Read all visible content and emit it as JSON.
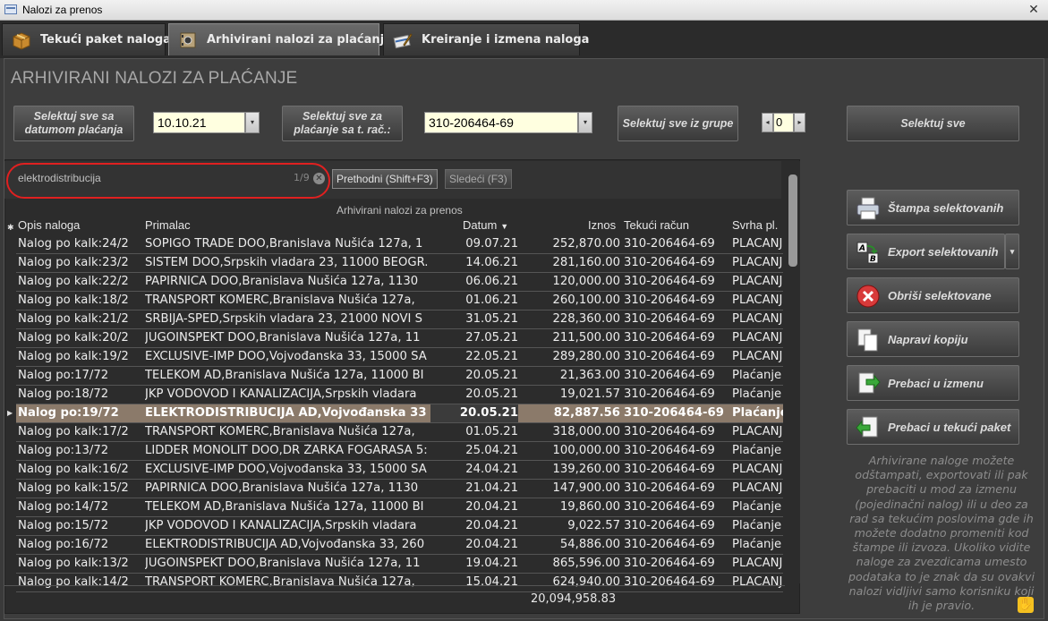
{
  "window": {
    "title": "Nalozi za prenos"
  },
  "tabs": [
    {
      "label": "Tekući paket naloga",
      "icon": "package-icon"
    },
    {
      "label": "Arhivirani nalozi za plaćanje",
      "icon": "safe-icon",
      "active": true
    },
    {
      "label": "Kreiranje i izmena naloga",
      "icon": "pen-card-icon"
    }
  ],
  "page_title": "ARHIVIRANI NALOZI ZA PLAĆANJE",
  "filters": {
    "select_by_date_label": "Selektuj sve sa datumom plaćanja",
    "date_value": "10.10.21",
    "select_by_account_label": "Selektuj sve za plaćanje sa t. rač.:",
    "account_value": "310-206464-69",
    "select_by_group_label": "Selektuj sve iz grupe",
    "group_value": "0",
    "select_all_label": "Selektuj sve"
  },
  "search": {
    "value": "elektrodistribucija",
    "count": "1/9",
    "prev_label": "Prethodni (Shift+F3)",
    "next_label": "Sledeći (F3)"
  },
  "grid": {
    "caption": "Arhivirani nalozi za prenos",
    "columns": [
      "Opis naloga",
      "Primalac",
      "Datum",
      "Iznos",
      "Tekući račun",
      "Svrha pl."
    ],
    "rows": [
      [
        "Nalog po kalk:24/2",
        "ŠOPIGO TRADE DOO,Branislava Nušića 127a, 1",
        "09.07.21",
        "252,870.00",
        "310-206464-69",
        "PLAĆANJ"
      ],
      [
        "Nalog po kalk:23/2",
        "SISTEM DOO,Srpskih vladara 23, 11000 BEOGR.",
        "14.06.21",
        "281,160.00",
        "310-206464-69",
        "PLAĆANJ"
      ],
      [
        "Nalog po kalk:22/2",
        "PAPIRNICA DOO,Branislava Nušića 127a, 1130",
        "06.06.21",
        "120,000.00",
        "310-206464-69",
        "PLAĆANJ"
      ],
      [
        "Nalog po kalk:18/2",
        "TRANSPORT KOMERC,Branislava Nušića 127a,",
        "01.06.21",
        "260,100.00",
        "310-206464-69",
        "PLAĆANJ"
      ],
      [
        "Nalog po kalk:21/2",
        "SRBIJA-ŠPED,Srpskih vladara 23, 21000 NOVI S",
        "31.05.21",
        "228,360.00",
        "310-206464-69",
        "PLAĆANJ"
      ],
      [
        "Nalog po kalk:20/2",
        "JUGOINSPEKT DOO,Branislava Nušića 127a, 11",
        "27.05.21",
        "211,500.00",
        "310-206464-69",
        "PLAĆANJ"
      ],
      [
        "Nalog po kalk:19/2",
        "EXCLUSIVE-IMP DOO,Vojvođanska 33, 15000 ŠA",
        "22.05.21",
        "289,280.00",
        "310-206464-69",
        "PLAĆANJ"
      ],
      [
        "Nalog po:17/72",
        "TELEKOM AD,Branislava Nušića 127a, 11000 BI",
        "20.05.21",
        "21,363.00",
        "310-206464-69",
        "Plaćanje"
      ],
      [
        "Nalog po:18/72",
        "JKP VODOVOD I KANALIZACIJA,Srpskih vladara",
        "20.05.21",
        "19,021.57",
        "310-206464-69",
        "Plaćanje"
      ],
      [
        "Nalog po:19/72",
        "ELEKTRODISTRIBUCIJA AD,Vojvođanska 33",
        "20.05.21",
        "82,887.56",
        "310-206464-69",
        "Plaćanje"
      ],
      [
        "Nalog po kalk:17/2",
        "TRANSPORT KOMERC,Branislava Nušića 127a,",
        "01.05.21",
        "318,000.00",
        "310-206464-69",
        "PLAĆANJ"
      ],
      [
        "Nalog po:13/72",
        "LIDDER MONOLIT DOO,DR ŽARKA FOGARAŠA 5:",
        "25.04.21",
        "100,000.00",
        "310-206464-69",
        "Plaćanje"
      ],
      [
        "Nalog po kalk:16/2",
        "EXCLUSIVE-IMP DOO,Vojvođanska 33, 15000 ŠA",
        "24.04.21",
        "139,260.00",
        "310-206464-69",
        "PLAĆANJ"
      ],
      [
        "Nalog po kalk:15/2",
        "PAPIRNICA DOO,Branislava Nušića 127a, 1130",
        "21.04.21",
        "147,900.00",
        "310-206464-69",
        "PLAĆANJ"
      ],
      [
        "Nalog po:14/72",
        "TELEKOM AD,Branislava Nušića 127a, 11000 BI",
        "20.04.21",
        "19,860.00",
        "310-206464-69",
        "Plaćanje"
      ],
      [
        "Nalog po:15/72",
        "JKP VODOVOD I KANALIZACIJA,Srpskih vladara",
        "20.04.21",
        "9,022.57",
        "310-206464-69",
        "Plaćanje"
      ],
      [
        "Nalog po:16/72",
        "ELEKTRODISTRIBUCIJA AD,Vojvođanska 33, 260",
        "20.04.21",
        "54,886.00",
        "310-206464-69",
        "Plaćanje"
      ],
      [
        "Nalog po kalk:13/2",
        "JUGOINSPEKT DOO,Branislava Nušića 127a, 11",
        "19.04.21",
        "865,596.00",
        "310-206464-69",
        "PLAĆANJ"
      ],
      [
        "Nalog po kalk:14/2",
        "TRANSPORT KOMERC,Branislava Nušića 127a,",
        "15.04.21",
        "624,940.00",
        "310-206464-69",
        "PLAĆANJ"
      ]
    ],
    "selected_row": 9,
    "total": "20,094,958.83"
  },
  "actions": [
    {
      "label": "Štampa selektovanih",
      "icon": "printer-icon"
    },
    {
      "label": "Export selektovanih",
      "icon": "export-ab-icon"
    },
    {
      "label": "Obriši selektovane",
      "icon": "delete-x-icon"
    },
    {
      "label": "Napravi kopiju",
      "icon": "copy-icon"
    },
    {
      "label": "Prebaci u izmenu",
      "icon": "move-to-edit-icon"
    },
    {
      "label": "Prebaci u tekući paket",
      "icon": "move-to-package-icon"
    }
  ],
  "help_text": "Arhivirane naloge možete odštampati, exportovati ili pak prebaciti u mod za izmenu (pojedinačni nalog) ili u deo za rad sa tekućim poslovima gde ih možete dodatno promeniti kod štampe ili izvoza. Ukoliko vidite naloge za zvezdicama umesto podataka to je znak da su ovakvi nalozi vidljivi samo korisniku koji ih je pravio.",
  "colors": {
    "selected_row": "#8b7a6a",
    "search_highlight": "#e02020",
    "input_bg": "#ffffe0"
  }
}
